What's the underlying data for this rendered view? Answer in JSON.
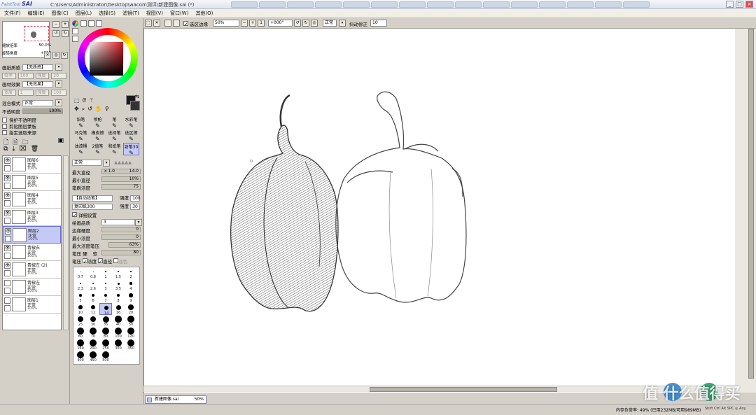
{
  "titlebar": {
    "logo": "SAI",
    "logo_sub": "PaintTool",
    "path": "C:\\Users\\Administrator\\Desktop\\wacom测评\\新建图像.sai (*)",
    "tabs": [
      "",
      "",
      "",
      "",
      "",
      "",
      "",
      "",
      "",
      "",
      "",
      "",
      "",
      "",
      ""
    ],
    "minimize": "_",
    "maximize": "□",
    "close": "×"
  },
  "menus": [
    "文件(F)",
    "编辑(E)",
    "图像(C)",
    "图层(L)",
    "选择(S)",
    "滤镜(T)",
    "视图(V)",
    "窗口(W)",
    "其他(O)"
  ],
  "left_panel": {
    "zoom_label": "缩放倍率",
    "zoom_value": "50.0%",
    "rotate_label": "旋转角度",
    "rotate_value": "+000",
    "paper_texture_label": "画纸质感",
    "paper_texture_value": "【无质感】",
    "paper_scale_label": "倍率",
    "paper_scale_value": "100",
    "paper_strength_label": "强度",
    "paper_strength_value": "20",
    "paper_effect_label": "画材效果",
    "paper_effect_value": "【无效果】",
    "effect_width_label": "宽度",
    "effect_width_value": "1",
    "effect_strength_label": "强度",
    "effect_strength_value": "100",
    "blend_label": "混合模式",
    "blend_value": "正常",
    "opacity_label": "不透明度",
    "opacity_value": "100%",
    "opacity_fraction": 1.0,
    "checkboxes": [
      "保护不透明度",
      "剪贴图层蒙板",
      "指定选取来源"
    ],
    "layers": [
      {
        "name": "图层6",
        "mode": "正常",
        "opacity": "100%",
        "visible": true,
        "selected": false
      },
      {
        "name": "图层5",
        "mode": "正常",
        "opacity": "100%",
        "visible": true,
        "selected": false
      },
      {
        "name": "图层4",
        "mode": "正常",
        "opacity": "100%",
        "visible": true,
        "selected": false
      },
      {
        "name": "图层3",
        "mode": "正常",
        "opacity": "100%",
        "visible": true,
        "selected": false
      },
      {
        "name": "图层2",
        "mode": "正常",
        "opacity": "100%",
        "visible": true,
        "selected": true
      },
      {
        "name": "青椒右",
        "mode": "正常",
        "opacity": "100%",
        "visible": true,
        "selected": false
      },
      {
        "name": "青椒左 (2)",
        "mode": "正常",
        "opacity": "100%",
        "visible": true,
        "selected": false
      },
      {
        "name": "青椒左",
        "mode": "正常",
        "opacity": "100%",
        "visible": false,
        "selected": false
      },
      {
        "name": "图层1",
        "mode": "正常",
        "opacity": "100%",
        "visible": false,
        "selected": false
      }
    ]
  },
  "tool_panel": {
    "fg_color": "#1a1a1a",
    "bg_color": "#333333",
    "brushes": [
      [
        "铅笔",
        "喷枪",
        "笔",
        "水彩笔"
      ],
      [
        "马克笔",
        "橡皮擦",
        "选择笔",
        "选区擦"
      ],
      [
        "油漆桶",
        "2值笔",
        "和纸笔",
        "铅笔30"
      ]
    ],
    "blend_mode": "正常",
    "max_size_label": "最大直径",
    "max_size_mult": "x 1.0",
    "max_size_value": "14.0",
    "min_size_label": "最小直径",
    "min_size_value": "10%",
    "density_label": "笔刷浓度",
    "density_value": "75",
    "shape_value": "【自动铅笔】",
    "shape_strength_label": "强度",
    "shape_strength_value": "100",
    "texture_value": "复印纸300",
    "texture_strength_label": "强度",
    "texture_strength_value": "30",
    "detail_label": "详细设置",
    "quality_label": "绘画品质",
    "quality_value": "3",
    "edge_label": "边缘硬度",
    "edge_value": "0",
    "min_density_label": "最小浓度",
    "min_density_value": "0",
    "max_pressure_label": "最大浓度笔压",
    "max_pressure_value": "63%",
    "pressure_label": "笔压",
    "pressure_hard": "硬",
    "pressure_soft": "软",
    "pressure_value": "80",
    "pressure_opts": [
      "浓度",
      "直径",
      "混色"
    ],
    "sizes": [
      "0.7",
      "0.8",
      "1",
      "1.5",
      "2",
      "2.3",
      "2.6",
      "3",
      "3.5",
      "4",
      "5",
      "6",
      "7",
      "8",
      "9",
      "10",
      "12",
      "14",
      "16",
      "20",
      "25",
      "30",
      "35",
      "40",
      "50",
      "60",
      "70",
      "80",
      "100",
      "120",
      "160",
      "200",
      "250",
      "300",
      "350",
      "400",
      "450",
      "500"
    ],
    "selected_size": "14"
  },
  "canvas_toolbar": {
    "zoom": "50%",
    "rotate": "+000°",
    "antialias_label": "选区边缘",
    "mode": "正常",
    "stabilizer_label": "抖动修正",
    "stabilizer_value": "10"
  },
  "status": {
    "doc_name": "新建图像.sai",
    "doc_zoom": "50%",
    "memory": "内存负荷率: 49% (已用232MB/可用989MB)",
    "keys": "Shift Ctrl Alt SPC ◎ Any",
    "watermark": "值 什么值得买"
  }
}
